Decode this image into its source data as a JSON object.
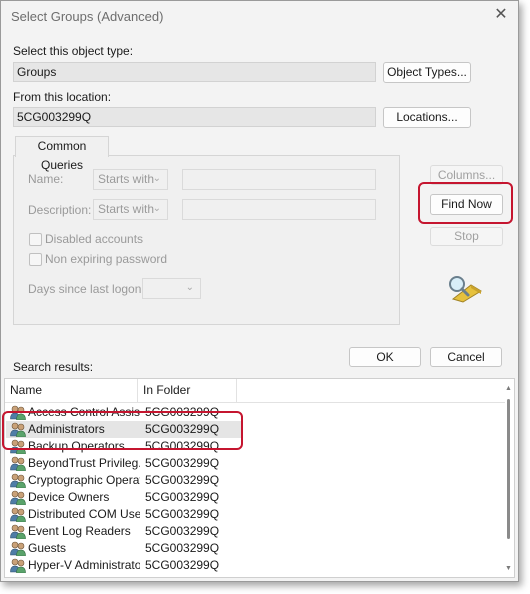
{
  "window": {
    "title": "Select Groups (Advanced)",
    "close_glyph": "✕"
  },
  "object_type": {
    "label": "Select this object type:",
    "value": "Groups",
    "button": "Object Types..."
  },
  "location": {
    "label": "From this location:",
    "value": "5CG003299Q",
    "button": "Locations..."
  },
  "common_queries": {
    "tab_label": "Common Queries",
    "name_label": "Name:",
    "name_mode": "Starts with",
    "description_label": "Description:",
    "description_mode": "Starts with",
    "disabled_accounts": "Disabled accounts",
    "non_expiring_password": "Non expiring password",
    "days_label": "Days since last logon:"
  },
  "side_buttons": {
    "columns": "Columns...",
    "find_now": "Find Now",
    "stop": "Stop"
  },
  "dialog_buttons": {
    "ok": "OK",
    "cancel": "Cancel"
  },
  "search_results": {
    "label": "Search results:",
    "columns": [
      "Name",
      "In Folder"
    ],
    "rows": [
      {
        "name": "Access Control Assis...",
        "folder": "5CG003299Q"
      },
      {
        "name": "Administrators",
        "folder": "5CG003299Q",
        "selected": true
      },
      {
        "name": "Backup Operators",
        "folder": "5CG003299Q"
      },
      {
        "name": "BeyondTrust Privileg...",
        "folder": "5CG003299Q"
      },
      {
        "name": "Cryptographic Operat...",
        "folder": "5CG003299Q"
      },
      {
        "name": "Device Owners",
        "folder": "5CG003299Q"
      },
      {
        "name": "Distributed COM Users",
        "folder": "5CG003299Q"
      },
      {
        "name": "Event Log Readers",
        "folder": "5CG003299Q"
      },
      {
        "name": "Guests",
        "folder": "5CG003299Q"
      },
      {
        "name": "Hyper-V Administrators",
        "folder": "5CG003299Q"
      }
    ]
  },
  "colors": {
    "highlight": "#c5152f",
    "selected_row": "#e5e5e5"
  },
  "icons": {
    "group": "group-users-icon",
    "search": "search-flashlight-icon"
  }
}
